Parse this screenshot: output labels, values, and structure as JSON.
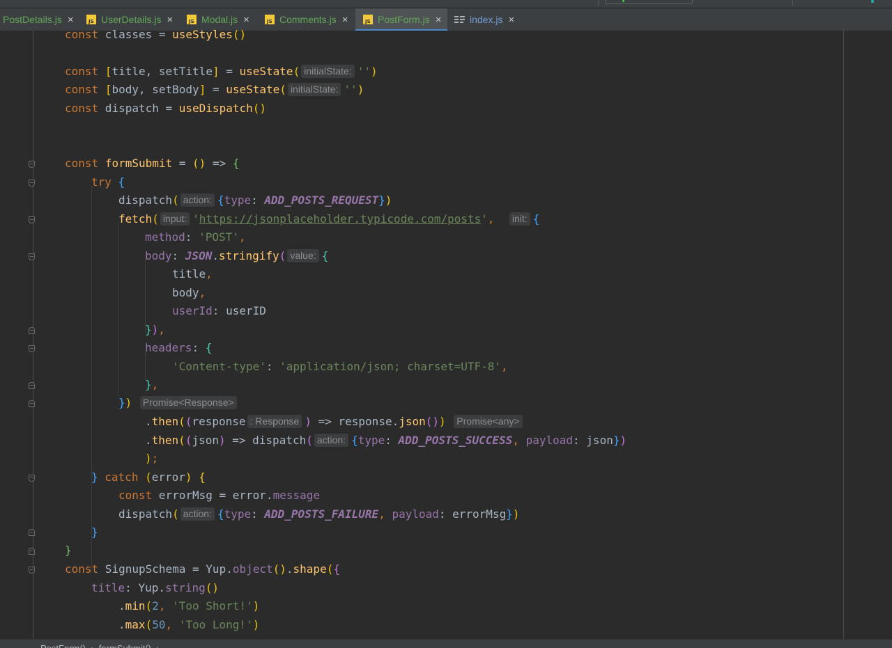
{
  "tabs": [
    {
      "name": "PostDetails.js",
      "icon": "js-file-icon",
      "active": false
    },
    {
      "name": "UserDetails.js",
      "icon": "js-file-icon",
      "active": false
    },
    {
      "name": "Modal.js",
      "icon": "js-file-icon",
      "active": false
    },
    {
      "name": "Comments.js",
      "icon": "js-file-icon",
      "active": false
    },
    {
      "name": "PostForm.js",
      "icon": "js-file-icon",
      "active": true
    },
    {
      "name": "index.js",
      "icon": "structure-list-icon",
      "active": false
    }
  ],
  "tab_close_glyph": "×",
  "js_icon_text": "JS",
  "editor": {
    "lines": [
      "const classes = useStyles()",
      "",
      "const [title, setTitle] = useState( initialState: '')",
      "const [body, setBody] = useState( initialState: '')",
      "const dispatch = useDispatch()",
      "",
      "",
      "const formSubmit = () => {",
      "    try {",
      "        dispatch( action: {type: ADD_POSTS_REQUEST})",
      "        fetch( input: 'https://jsonplaceholder.typicode.com/posts',  init: {",
      "            method: 'POST',",
      "            body: JSON.stringify( value: {",
      "                title,",
      "                body,",
      "                userId: userID",
      "            }),",
      "            headers: {",
      "                'Content-type': 'application/json; charset=UTF-8',",
      "            },",
      "        }) Promise<Response>",
      "            .then((response : Response ) => response.json()) Promise<any>",
      "            .then((json) => dispatch( action: {type: ADD_POSTS_SUCCESS, payload: json})",
      "            );",
      "    } catch (error) {",
      "        const errorMsg = error.message",
      "        dispatch( action: {type: ADD_POSTS_FAILURE, payload: errorMsg})",
      "    }",
      "}",
      "const SignupSchema = Yup.object().shape({",
      "    title: Yup.string()",
      "        .min(2, 'Too Short!')",
      "        .max(50, 'Too Long!')"
    ]
  },
  "colors": {
    "background": "#2b2b2b",
    "keyword": "#cc7832",
    "function": "#ffc66d",
    "string": "#6a8759",
    "number": "#6897bb",
    "property": "#9876aa",
    "accent": "#4a88c7"
  }
}
